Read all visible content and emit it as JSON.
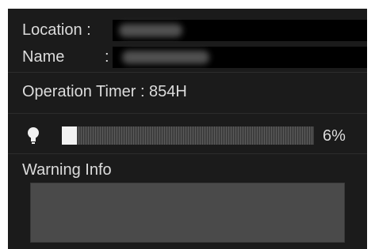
{
  "location": {
    "label": "Location :",
    "value": ""
  },
  "name": {
    "label": "Name",
    "separator": ":",
    "value": ""
  },
  "operation_timer": {
    "label": "Operation Timer : 854H"
  },
  "lamp_life": {
    "percent_label": "6%",
    "level_fraction": 0.06
  },
  "warning": {
    "label": "Warning Info",
    "text": ""
  },
  "colors": {
    "panel_bg": "#1b1b1b",
    "text": "#dcdcdc",
    "bar_fill": "#f2f2f2"
  },
  "icons": {
    "lamp": "light-bulb-icon"
  }
}
